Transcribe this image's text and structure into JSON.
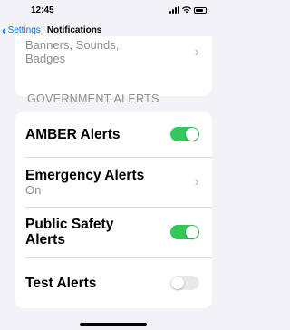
{
  "status": {
    "time": "12:45",
    "battery_level": 0.8
  },
  "nav": {
    "back_label": "Settings",
    "back_icon": "chevron-left-icon",
    "title": "Notifications"
  },
  "top_row": {
    "text": "Banners, Sounds, Badges"
  },
  "section": {
    "header": "GOVERNMENT ALERTS"
  },
  "rows": [
    {
      "label": "AMBER Alerts",
      "control": "toggle",
      "on": true
    },
    {
      "label": "Emergency Alerts",
      "sublabel": "On",
      "control": "chevron"
    },
    {
      "label": "Public Safety Alerts",
      "control": "toggle",
      "on": true
    },
    {
      "label": "Test Alerts",
      "control": "toggle",
      "on": false
    }
  ],
  "colors": {
    "accent": "#007aff",
    "toggle_on": "#34c759",
    "toggle_off": "#e9e9eb",
    "background": "#f2f2f7"
  }
}
